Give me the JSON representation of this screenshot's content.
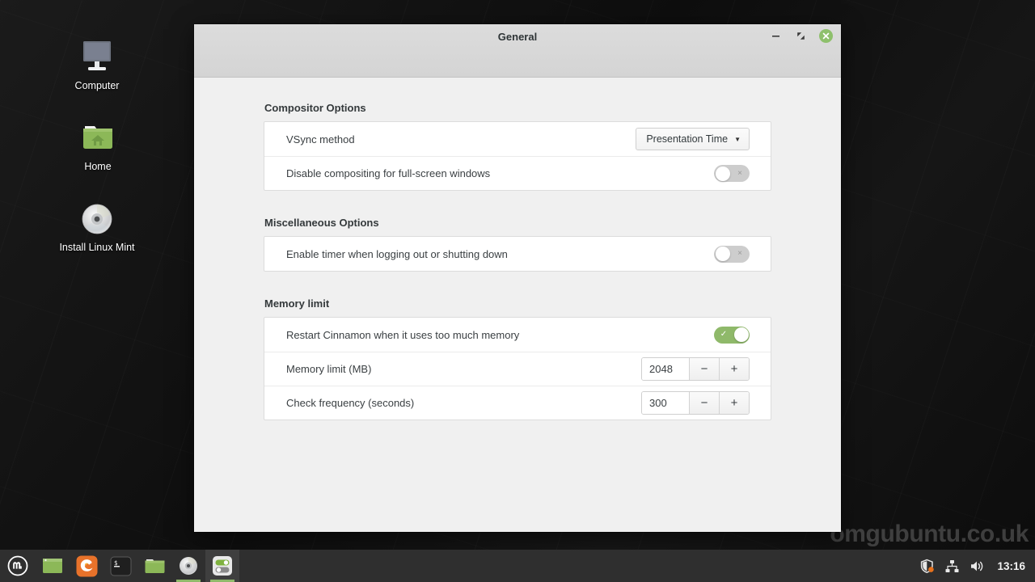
{
  "desktop": {
    "wallpaper_color": "#141414",
    "watermark": "omgubuntu.co.uk",
    "icons": [
      {
        "label": "Computer",
        "icon": "computer-monitor-icon"
      },
      {
        "label": "Home",
        "icon": "home-folder-icon"
      },
      {
        "label": "Install Linux Mint",
        "icon": "optical-disc-icon"
      }
    ]
  },
  "window": {
    "title": "General",
    "controls": {
      "minimize": "minimize-icon",
      "maximize": "maximize-icon",
      "close": "close-icon",
      "close_color": "#8ec06c"
    }
  },
  "sections": [
    {
      "title": "Compositor Options",
      "rows": [
        {
          "label": "VSync method",
          "control": "dropdown",
          "value": "Presentation Time",
          "options": [
            "Presentation Time"
          ]
        },
        {
          "label": "Disable compositing for full-screen windows",
          "control": "switch",
          "state": "off",
          "off_mark": "×"
        }
      ]
    },
    {
      "title": "Miscellaneous Options",
      "rows": [
        {
          "label": "Enable timer when logging out or shutting down",
          "control": "switch",
          "state": "off",
          "off_mark": "×"
        }
      ]
    },
    {
      "title": "Memory limit",
      "rows": [
        {
          "label": "Restart Cinnamon when it uses too much memory",
          "control": "switch",
          "state": "on",
          "on_mark": "✓",
          "on_color": "#8fb96a"
        },
        {
          "label": "Memory limit (MB)",
          "control": "spinner",
          "value": "2048",
          "minus": "−",
          "plus": "+"
        },
        {
          "label": "Check frequency (seconds)",
          "control": "spinner",
          "value": "300",
          "minus": "−",
          "plus": "+"
        }
      ]
    }
  ],
  "panel": {
    "menu_button": "mint-menu-icon",
    "launchers": [
      {
        "name": "show-desktop-icon",
        "state": "idle"
      },
      {
        "name": "firefox-icon",
        "state": "idle"
      },
      {
        "name": "terminal-icon",
        "state": "idle"
      },
      {
        "name": "files-icon",
        "state": "idle"
      },
      {
        "name": "optical-disc-icon",
        "state": "running"
      },
      {
        "name": "system-settings-icon",
        "state": "active"
      }
    ],
    "tray": [
      {
        "name": "update-manager-shield-icon",
        "badge_color": "#e8721c"
      },
      {
        "name": "network-icon"
      },
      {
        "name": "volume-icon"
      }
    ],
    "clock": "13:16"
  }
}
